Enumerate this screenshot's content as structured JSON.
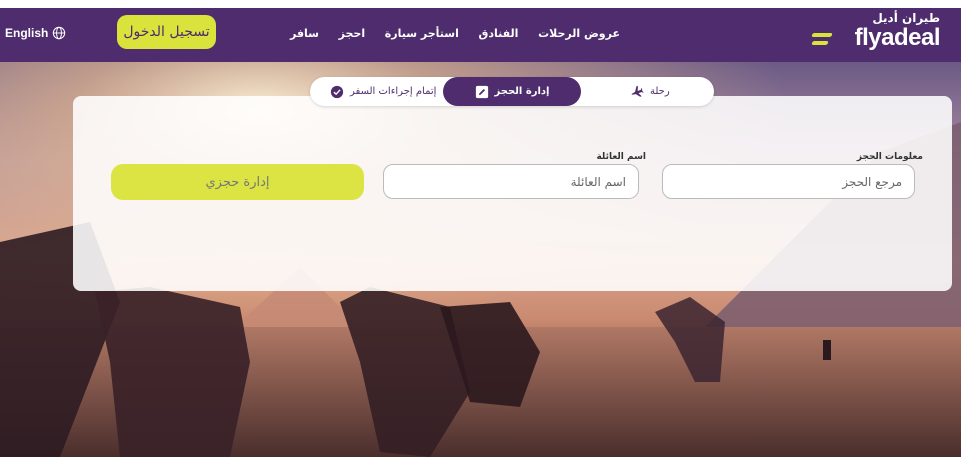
{
  "header": {
    "language_label": "English",
    "login_label": "تسجيل الدخول",
    "nav": [
      "سافر",
      "احجز",
      "استأجر سيارة",
      "الفنادق",
      "عروض الرحلات"
    ],
    "logo_arabic": "طيران أديل",
    "logo_english": "flyadeal"
  },
  "tabs": {
    "checkin": "إتمام إجراءات السفر",
    "manage": "إدارة الحجز",
    "trip": "رحلة"
  },
  "form": {
    "booking_label": "معلومات الحجز",
    "booking_placeholder": "مرجع الحجز",
    "lastname_label": "اسم العائلة",
    "lastname_placeholder": "اسم العائلة",
    "submit_label": "إدارة حجزي"
  },
  "colors": {
    "brand_purple": "#4e2c6d",
    "brand_yellow": "#d9e33b"
  },
  "icons": {
    "language": "globe-icon",
    "checkin": "check-circle-icon",
    "manage": "edit-icon",
    "trip": "plane-icon"
  }
}
